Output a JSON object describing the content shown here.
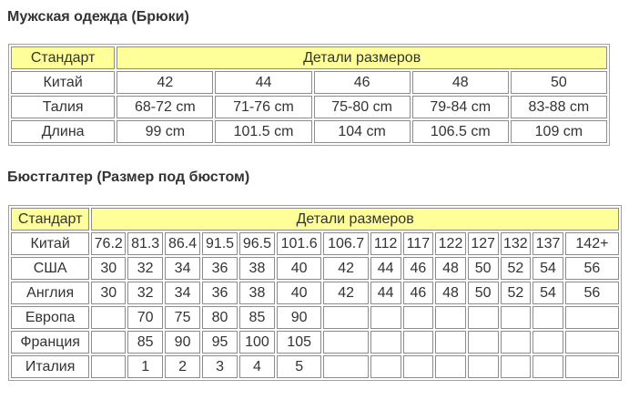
{
  "pants": {
    "title": "Мужская одежда (Брюки)",
    "header": {
      "standard": "Стандарт",
      "details": "Детали размеров"
    },
    "rows": [
      {
        "label": "Китай",
        "values": [
          "42",
          "44",
          "46",
          "48",
          "50"
        ]
      },
      {
        "label": "Талия",
        "values": [
          "68-72 cm",
          "71-76 cm",
          "75-80 cm",
          "79-84 cm",
          "83-88 cm"
        ]
      },
      {
        "label": "Длина",
        "values": [
          "99 cm",
          "101.5 cm",
          "104 cm",
          "106.5 cm",
          "109 cm"
        ]
      }
    ]
  },
  "bra": {
    "title": "Бюстгалтер (Размер под бюстом)",
    "header": {
      "standard": "Стандарт",
      "details": "Детали размеров"
    },
    "rows": [
      {
        "label": "Китай",
        "values": [
          "76.2",
          "81.3",
          "86.4",
          "91.5",
          "96.5",
          "101.6",
          "106.7",
          "112",
          "117",
          "122",
          "127",
          "132",
          "137",
          "142+"
        ]
      },
      {
        "label": "США",
        "values": [
          "30",
          "32",
          "34",
          "36",
          "38",
          "40",
          "42",
          "44",
          "46",
          "48",
          "50",
          "52",
          "54",
          "56"
        ]
      },
      {
        "label": "Англия",
        "values": [
          "30",
          "32",
          "34",
          "36",
          "38",
          "40",
          "42",
          "44",
          "46",
          "48",
          "50",
          "52",
          "54",
          "56"
        ]
      },
      {
        "label": "Европа",
        "values": [
          "",
          "70",
          "75",
          "80",
          "85",
          "90",
          "",
          "",
          "",
          "",
          "",
          "",
          "",
          ""
        ]
      },
      {
        "label": "Франция",
        "values": [
          "",
          "85",
          "90",
          "95",
          "100",
          "105",
          "",
          "",
          "",
          "",
          "",
          "",
          "",
          ""
        ]
      },
      {
        "label": "Италия",
        "values": [
          "",
          "1",
          "2",
          "3",
          "4",
          "5",
          "",
          "",
          "",
          "",
          "",
          "",
          "",
          ""
        ]
      }
    ]
  },
  "colors": {
    "header_bg": "#ffff99",
    "border": "#8c8c8c",
    "text": "#333333"
  }
}
